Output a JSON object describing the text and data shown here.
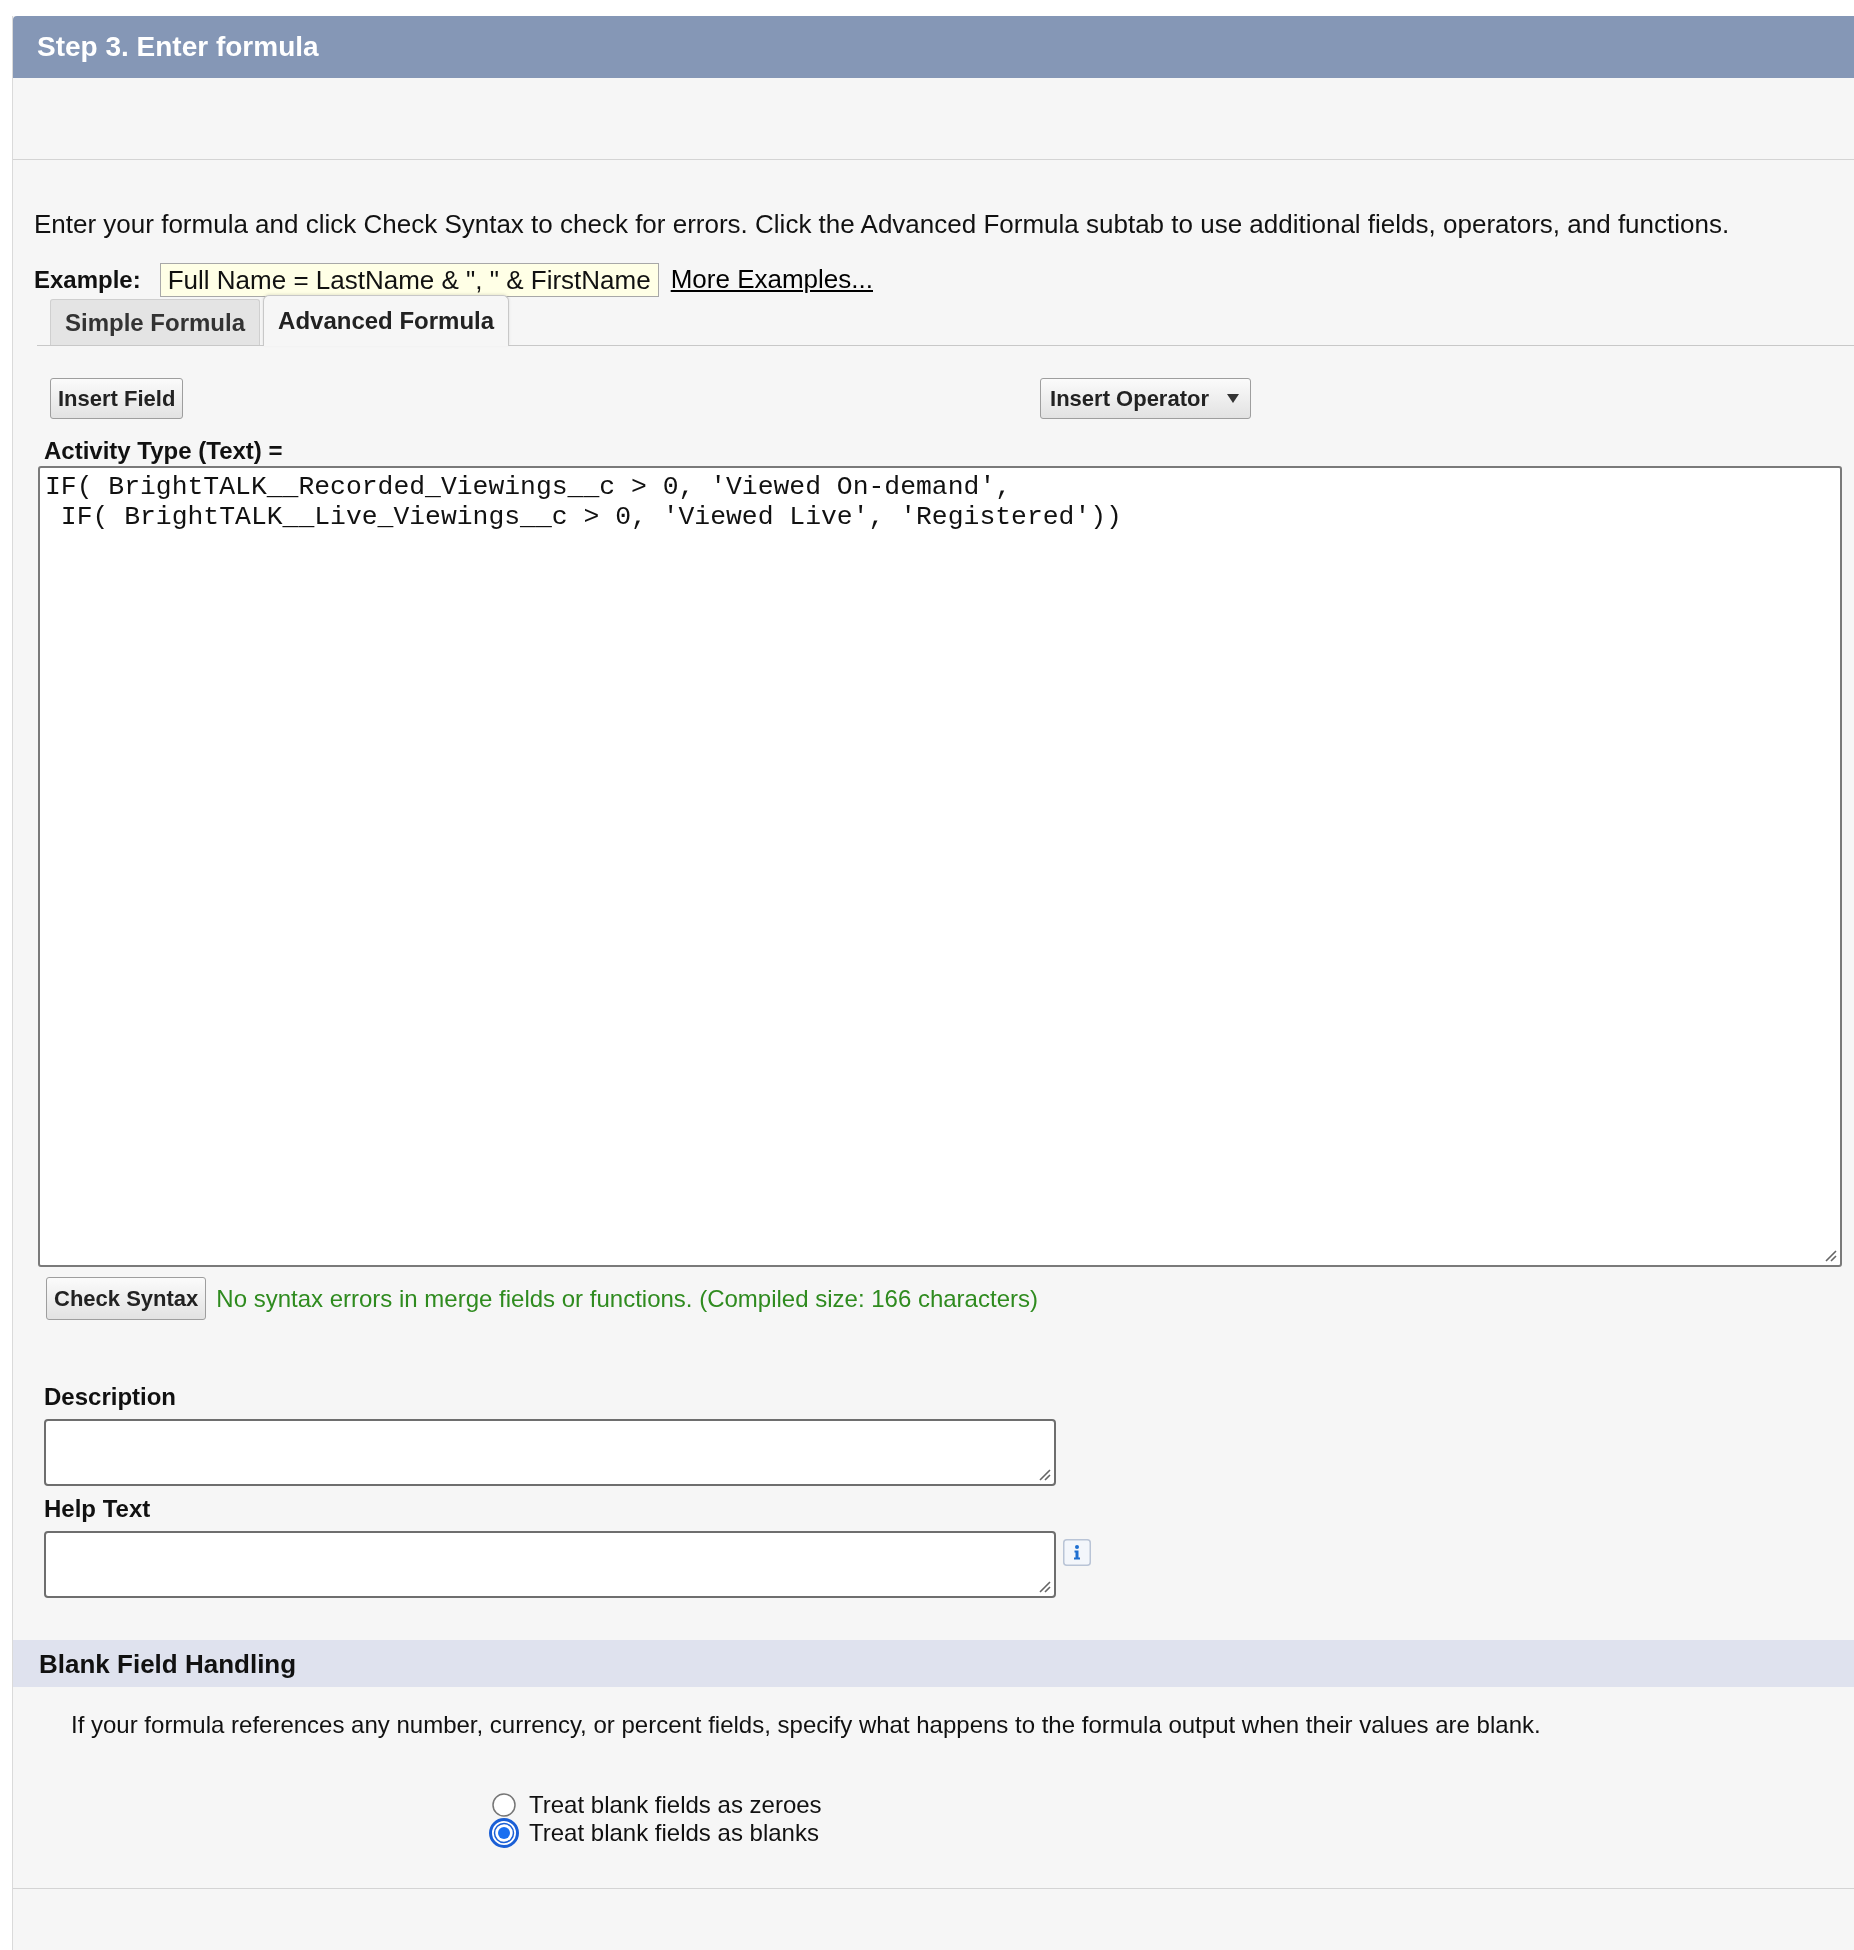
{
  "step_header": {
    "title": "Step 3. Enter formula"
  },
  "instructions": "Enter your formula and click Check Syntax to check for errors. Click the Advanced Formula subtab to use additional fields, operators, and functions.",
  "example": {
    "label": "Example:",
    "value": "Full Name = LastName & \", \" & FirstName",
    "link": "More Examples..."
  },
  "tabs": [
    {
      "label": "Simple Formula",
      "selected": false
    },
    {
      "label": "Advanced Formula",
      "selected": true
    }
  ],
  "toolbar": {
    "insert_field": "Insert Field",
    "insert_operator": "Insert Operator"
  },
  "formula": {
    "label": "Activity Type (Text) =",
    "value": "IF( BrightTALK__Recorded_Viewings__c > 0, 'Viewed On-demand',\n IF( BrightTALK__Live_Viewings__c > 0, 'Viewed Live', 'Registered'))"
  },
  "check_syntax": {
    "button": "Check Syntax",
    "message": "No syntax errors in merge fields or functions. (Compiled size: 166 characters)"
  },
  "description": {
    "label": "Description"
  },
  "help_text": {
    "label": "Help Text"
  },
  "blank_field_handling": {
    "title": "Blank Field Handling",
    "text": "If your formula references any number, currency, or percent fields, specify what happens to the formula output when their values are blank.",
    "options": [
      {
        "label": "Treat blank fields as zeroes",
        "selected": false
      },
      {
        "label": "Treat blank fields as blanks",
        "selected": true
      }
    ]
  }
}
